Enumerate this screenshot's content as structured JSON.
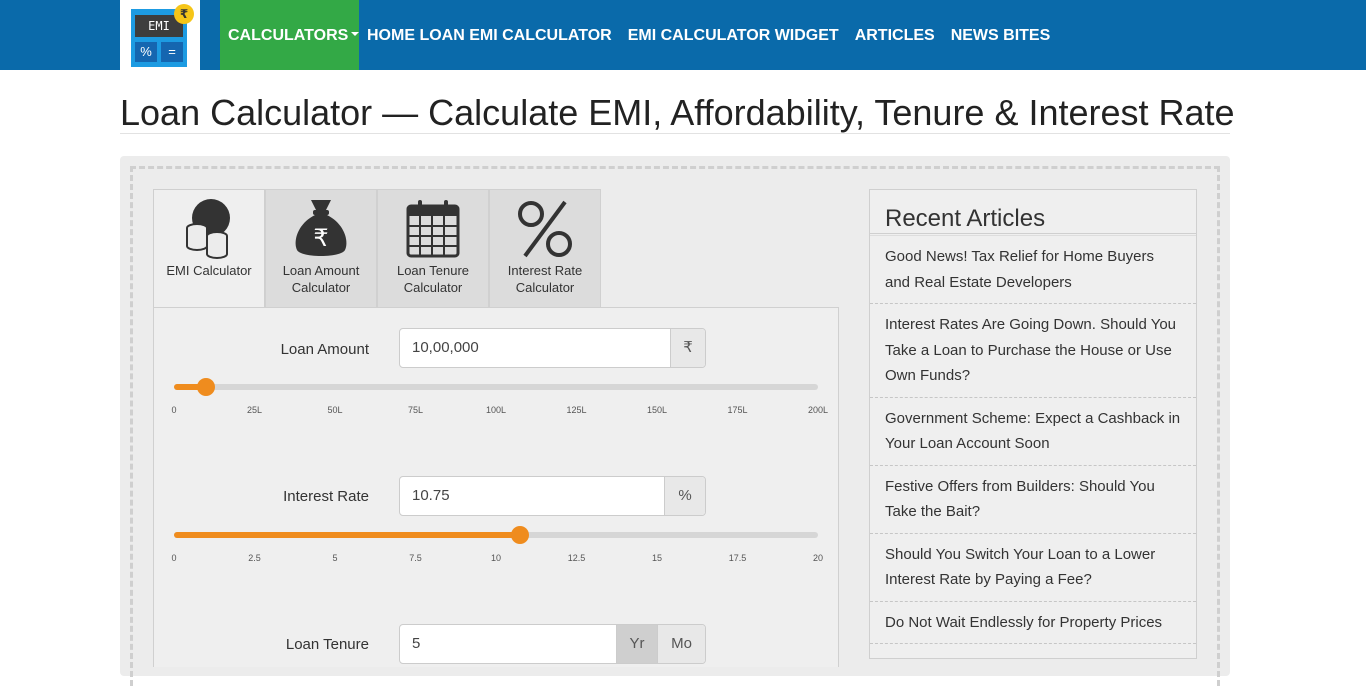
{
  "logo": {
    "screen_text": "EMI",
    "key1": "%",
    "key2": "=",
    "coin": "₹"
  },
  "nav": {
    "items": [
      {
        "label": "CALCULATORS"
      },
      {
        "label": "HOME LOAN EMI CALCULATOR"
      },
      {
        "label": "EMI CALCULATOR WIDGET"
      },
      {
        "label": "ARTICLES"
      },
      {
        "label": "NEWS BITES"
      }
    ]
  },
  "page_title": "Loan Calculator — Calculate EMI, Affordability, Tenure & Interest Rate",
  "tabs": [
    {
      "label": "EMI Calculator",
      "icon": "coins-icon",
      "active": true
    },
    {
      "label": "Loan Amount Calculator",
      "icon": "money-bag-icon"
    },
    {
      "label": "Loan Tenure Calculator",
      "icon": "calendar-icon"
    },
    {
      "label": "Interest Rate Calculator",
      "icon": "percent-icon"
    }
  ],
  "loan_amount": {
    "label": "Loan Amount",
    "value": "10,00,000",
    "unit": "₹",
    "slider_fraction": 0.05,
    "ticks": [
      "0",
      "25L",
      "50L",
      "75L",
      "100L",
      "125L",
      "150L",
      "175L",
      "200L"
    ]
  },
  "interest_rate": {
    "label": "Interest Rate",
    "value": "10.75",
    "unit": "%",
    "slider_fraction": 0.5375,
    "ticks": [
      "0",
      "2.5",
      "5",
      "7.5",
      "10",
      "12.5",
      "15",
      "17.5",
      "20"
    ]
  },
  "loan_tenure": {
    "label": "Loan Tenure",
    "value": "5",
    "unit_year": "Yr",
    "unit_month": "Mo"
  },
  "sidebar": {
    "title": "Recent Articles",
    "articles": [
      "Good News! Tax Relief for Home Buyers and Real Estate Developers",
      "Interest Rates Are Going Down. Should You Take a Loan to Purchase the House or Use Own Funds?",
      "Government Scheme: Expect a Cashback in Your Loan Account Soon",
      "Festive Offers from Builders: Should You Take the Bait?",
      "Should You Switch Your Loan to a Lower Interest Rate by Paying a Fee?",
      "Do Not Wait Endlessly for Property Prices"
    ]
  },
  "colors": {
    "topbar": "#0a6aaa",
    "active_nav": "#33a946",
    "slider": "#ef8c1e"
  }
}
